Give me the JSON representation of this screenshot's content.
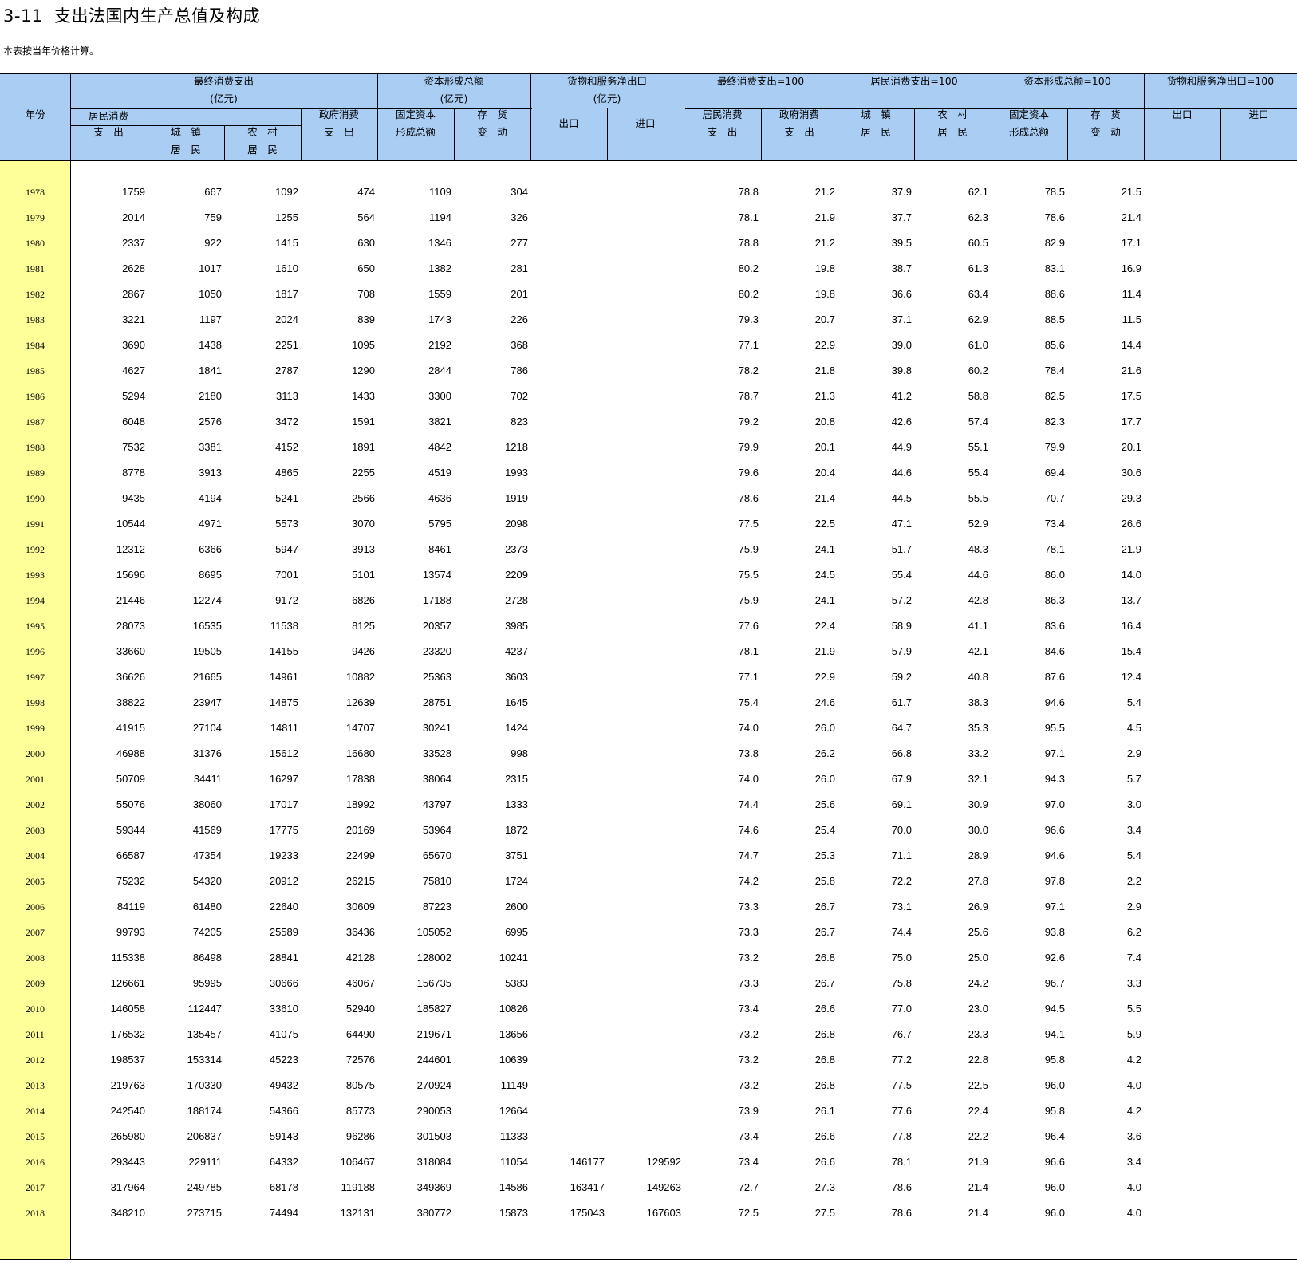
{
  "title": "3-11  支出法国内生产总值及构成",
  "note": "本表按当年价格计算。",
  "headers": {
    "year": "年份",
    "group_final": "最终消费支出",
    "group_capital": "资本形成总额",
    "group_netexport": "货物和服务净出口",
    "unit": "(亿元)",
    "group_final_pct": "最终消费支出=100",
    "group_household_pct": "居民消费支出=100",
    "group_capital_pct": "资本形成总额=100",
    "group_netexport_pct": "货物和服务净出口=100",
    "household_line1": "居民消费",
    "household_line2": "支　出",
    "urban_line1": "城　镇",
    "urban_line2": "居　民",
    "rural_line1": "农　村",
    "rural_line2": "居　民",
    "gov_line1": "政府消费",
    "gov_line2": "支　出",
    "fixed_line1": "固定资本",
    "fixed_line2": "形成总额",
    "inventory_line1": "存　货",
    "inventory_line2": "变　动",
    "export": "出口",
    "import": "进口",
    "p_household_line1": "居民消费",
    "p_household_line2": "支　出",
    "p_gov_line1": "政府消费",
    "p_gov_line2": "支　出",
    "p_urban_line1": "城　镇",
    "p_urban_line2": "居　民",
    "p_rural_line1": "农　村",
    "p_rural_line2": "居　民",
    "p_fixed_line1": "固定资本",
    "p_fixed_line2": "形成总额",
    "p_inventory_line1": "存　货",
    "p_inventory_line2": "变　动",
    "p_export": "出口",
    "p_import": "进口"
  },
  "rows": [
    [
      "1978",
      "1759",
      "667",
      "1092",
      "474",
      "1109",
      "304",
      "",
      "",
      "78.8",
      "21.2",
      "37.9",
      "62.1",
      "78.5",
      "21.5",
      "",
      ""
    ],
    [
      "1979",
      "2014",
      "759",
      "1255",
      "564",
      "1194",
      "326",
      "",
      "",
      "78.1",
      "21.9",
      "37.7",
      "62.3",
      "78.6",
      "21.4",
      "",
      ""
    ],
    [
      "1980",
      "2337",
      "922",
      "1415",
      "630",
      "1346",
      "277",
      "",
      "",
      "78.8",
      "21.2",
      "39.5",
      "60.5",
      "82.9",
      "17.1",
      "",
      ""
    ],
    [
      "1981",
      "2628",
      "1017",
      "1610",
      "650",
      "1382",
      "281",
      "",
      "",
      "80.2",
      "19.8",
      "38.7",
      "61.3",
      "83.1",
      "16.9",
      "",
      ""
    ],
    [
      "1982",
      "2867",
      "1050",
      "1817",
      "708",
      "1559",
      "201",
      "",
      "",
      "80.2",
      "19.8",
      "36.6",
      "63.4",
      "88.6",
      "11.4",
      "",
      ""
    ],
    [
      "1983",
      "3221",
      "1197",
      "2024",
      "839",
      "1743",
      "226",
      "",
      "",
      "79.3",
      "20.7",
      "37.1",
      "62.9",
      "88.5",
      "11.5",
      "",
      ""
    ],
    [
      "1984",
      "3690",
      "1438",
      "2251",
      "1095",
      "2192",
      "368",
      "",
      "",
      "77.1",
      "22.9",
      "39.0",
      "61.0",
      "85.6",
      "14.4",
      "",
      ""
    ],
    [
      "1985",
      "4627",
      "1841",
      "2787",
      "1290",
      "2844",
      "786",
      "",
      "",
      "78.2",
      "21.8",
      "39.8",
      "60.2",
      "78.4",
      "21.6",
      "",
      ""
    ],
    [
      "1986",
      "5294",
      "2180",
      "3113",
      "1433",
      "3300",
      "702",
      "",
      "",
      "78.7",
      "21.3",
      "41.2",
      "58.8",
      "82.5",
      "17.5",
      "",
      ""
    ],
    [
      "1987",
      "6048",
      "2576",
      "3472",
      "1591",
      "3821",
      "823",
      "",
      "",
      "79.2",
      "20.8",
      "42.6",
      "57.4",
      "82.3",
      "17.7",
      "",
      ""
    ],
    [
      "1988",
      "7532",
      "3381",
      "4152",
      "1891",
      "4842",
      "1218",
      "",
      "",
      "79.9",
      "20.1",
      "44.9",
      "55.1",
      "79.9",
      "20.1",
      "",
      ""
    ],
    [
      "1989",
      "8778",
      "3913",
      "4865",
      "2255",
      "4519",
      "1993",
      "",
      "",
      "79.6",
      "20.4",
      "44.6",
      "55.4",
      "69.4",
      "30.6",
      "",
      ""
    ],
    [
      "1990",
      "9435",
      "4194",
      "5241",
      "2566",
      "4636",
      "1919",
      "",
      "",
      "78.6",
      "21.4",
      "44.5",
      "55.5",
      "70.7",
      "29.3",
      "",
      ""
    ],
    [
      "1991",
      "10544",
      "4971",
      "5573",
      "3070",
      "5795",
      "2098",
      "",
      "",
      "77.5",
      "22.5",
      "47.1",
      "52.9",
      "73.4",
      "26.6",
      "",
      ""
    ],
    [
      "1992",
      "12312",
      "6366",
      "5947",
      "3913",
      "8461",
      "2373",
      "",
      "",
      "75.9",
      "24.1",
      "51.7",
      "48.3",
      "78.1",
      "21.9",
      "",
      ""
    ],
    [
      "1993",
      "15696",
      "8695",
      "7001",
      "5101",
      "13574",
      "2209",
      "",
      "",
      "75.5",
      "24.5",
      "55.4",
      "44.6",
      "86.0",
      "14.0",
      "",
      ""
    ],
    [
      "1994",
      "21446",
      "12274",
      "9172",
      "6826",
      "17188",
      "2728",
      "",
      "",
      "75.9",
      "24.1",
      "57.2",
      "42.8",
      "86.3",
      "13.7",
      "",
      ""
    ],
    [
      "1995",
      "28073",
      "16535",
      "11538",
      "8125",
      "20357",
      "3985",
      "",
      "",
      "77.6",
      "22.4",
      "58.9",
      "41.1",
      "83.6",
      "16.4",
      "",
      ""
    ],
    [
      "1996",
      "33660",
      "19505",
      "14155",
      "9426",
      "23320",
      "4237",
      "",
      "",
      "78.1",
      "21.9",
      "57.9",
      "42.1",
      "84.6",
      "15.4",
      "",
      ""
    ],
    [
      "1997",
      "36626",
      "21665",
      "14961",
      "10882",
      "25363",
      "3603",
      "",
      "",
      "77.1",
      "22.9",
      "59.2",
      "40.8",
      "87.6",
      "12.4",
      "",
      ""
    ],
    [
      "1998",
      "38822",
      "23947",
      "14875",
      "12639",
      "28751",
      "1645",
      "",
      "",
      "75.4",
      "24.6",
      "61.7",
      "38.3",
      "94.6",
      "5.4",
      "",
      ""
    ],
    [
      "1999",
      "41915",
      "27104",
      "14811",
      "14707",
      "30241",
      "1424",
      "",
      "",
      "74.0",
      "26.0",
      "64.7",
      "35.3",
      "95.5",
      "4.5",
      "",
      ""
    ],
    [
      "2000",
      "46988",
      "31376",
      "15612",
      "16680",
      "33528",
      "998",
      "",
      "",
      "73.8",
      "26.2",
      "66.8",
      "33.2",
      "97.1",
      "2.9",
      "",
      ""
    ],
    [
      "2001",
      "50709",
      "34411",
      "16297",
      "17838",
      "38064",
      "2315",
      "",
      "",
      "74.0",
      "26.0",
      "67.9",
      "32.1",
      "94.3",
      "5.7",
      "",
      ""
    ],
    [
      "2002",
      "55076",
      "38060",
      "17017",
      "18992",
      "43797",
      "1333",
      "",
      "",
      "74.4",
      "25.6",
      "69.1",
      "30.9",
      "97.0",
      "3.0",
      "",
      ""
    ],
    [
      "2003",
      "59344",
      "41569",
      "17775",
      "20169",
      "53964",
      "1872",
      "",
      "",
      "74.6",
      "25.4",
      "70.0",
      "30.0",
      "96.6",
      "3.4",
      "",
      ""
    ],
    [
      "2004",
      "66587",
      "47354",
      "19233",
      "22499",
      "65670",
      "3751",
      "",
      "",
      "74.7",
      "25.3",
      "71.1",
      "28.9",
      "94.6",
      "5.4",
      "",
      ""
    ],
    [
      "2005",
      "75232",
      "54320",
      "20912",
      "26215",
      "75810",
      "1724",
      "",
      "",
      "74.2",
      "25.8",
      "72.2",
      "27.8",
      "97.8",
      "2.2",
      "",
      ""
    ],
    [
      "2006",
      "84119",
      "61480",
      "22640",
      "30609",
      "87223",
      "2600",
      "",
      "",
      "73.3",
      "26.7",
      "73.1",
      "26.9",
      "97.1",
      "2.9",
      "",
      ""
    ],
    [
      "2007",
      "99793",
      "74205",
      "25589",
      "36436",
      "105052",
      "6995",
      "",
      "",
      "73.3",
      "26.7",
      "74.4",
      "25.6",
      "93.8",
      "6.2",
      "",
      ""
    ],
    [
      "2008",
      "115338",
      "86498",
      "28841",
      "42128",
      "128002",
      "10241",
      "",
      "",
      "73.2",
      "26.8",
      "75.0",
      "25.0",
      "92.6",
      "7.4",
      "",
      ""
    ],
    [
      "2009",
      "126661",
      "95995",
      "30666",
      "46067",
      "156735",
      "5383",
      "",
      "",
      "73.3",
      "26.7",
      "75.8",
      "24.2",
      "96.7",
      "3.3",
      "",
      ""
    ],
    [
      "2010",
      "146058",
      "112447",
      "33610",
      "52940",
      "185827",
      "10826",
      "",
      "",
      "73.4",
      "26.6",
      "77.0",
      "23.0",
      "94.5",
      "5.5",
      "",
      ""
    ],
    [
      "2011",
      "176532",
      "135457",
      "41075",
      "64490",
      "219671",
      "13656",
      "",
      "",
      "73.2",
      "26.8",
      "76.7",
      "23.3",
      "94.1",
      "5.9",
      "",
      ""
    ],
    [
      "2012",
      "198537",
      "153314",
      "45223",
      "72576",
      "244601",
      "10639",
      "",
      "",
      "73.2",
      "26.8",
      "77.2",
      "22.8",
      "95.8",
      "4.2",
      "",
      ""
    ],
    [
      "2013",
      "219763",
      "170330",
      "49432",
      "80575",
      "270924",
      "11149",
      "",
      "",
      "73.2",
      "26.8",
      "77.5",
      "22.5",
      "96.0",
      "4.0",
      "",
      ""
    ],
    [
      "2014",
      "242540",
      "188174",
      "54366",
      "85773",
      "290053",
      "12664",
      "",
      "",
      "73.9",
      "26.1",
      "77.6",
      "22.4",
      "95.8",
      "4.2",
      "",
      ""
    ],
    [
      "2015",
      "265980",
      "206837",
      "59143",
      "96286",
      "301503",
      "11333",
      "",
      "",
      "73.4",
      "26.6",
      "77.8",
      "22.2",
      "96.4",
      "3.6",
      "",
      ""
    ],
    [
      "2016",
      "293443",
      "229111",
      "64332",
      "106467",
      "318084",
      "11054",
      "146177",
      "129592",
      "73.4",
      "26.6",
      "78.1",
      "21.9",
      "96.6",
      "3.4",
      "",
      ""
    ],
    [
      "2017",
      "317964",
      "249785",
      "68178",
      "119188",
      "349369",
      "14586",
      "163417",
      "149263",
      "72.7",
      "27.3",
      "78.6",
      "21.4",
      "96.0",
      "4.0",
      "",
      ""
    ],
    [
      "2018",
      "348210",
      "273715",
      "74494",
      "132131",
      "380772",
      "15873",
      "175043",
      "167603",
      "72.5",
      "27.5",
      "78.6",
      "21.4",
      "96.0",
      "4.0",
      "",
      ""
    ]
  ]
}
